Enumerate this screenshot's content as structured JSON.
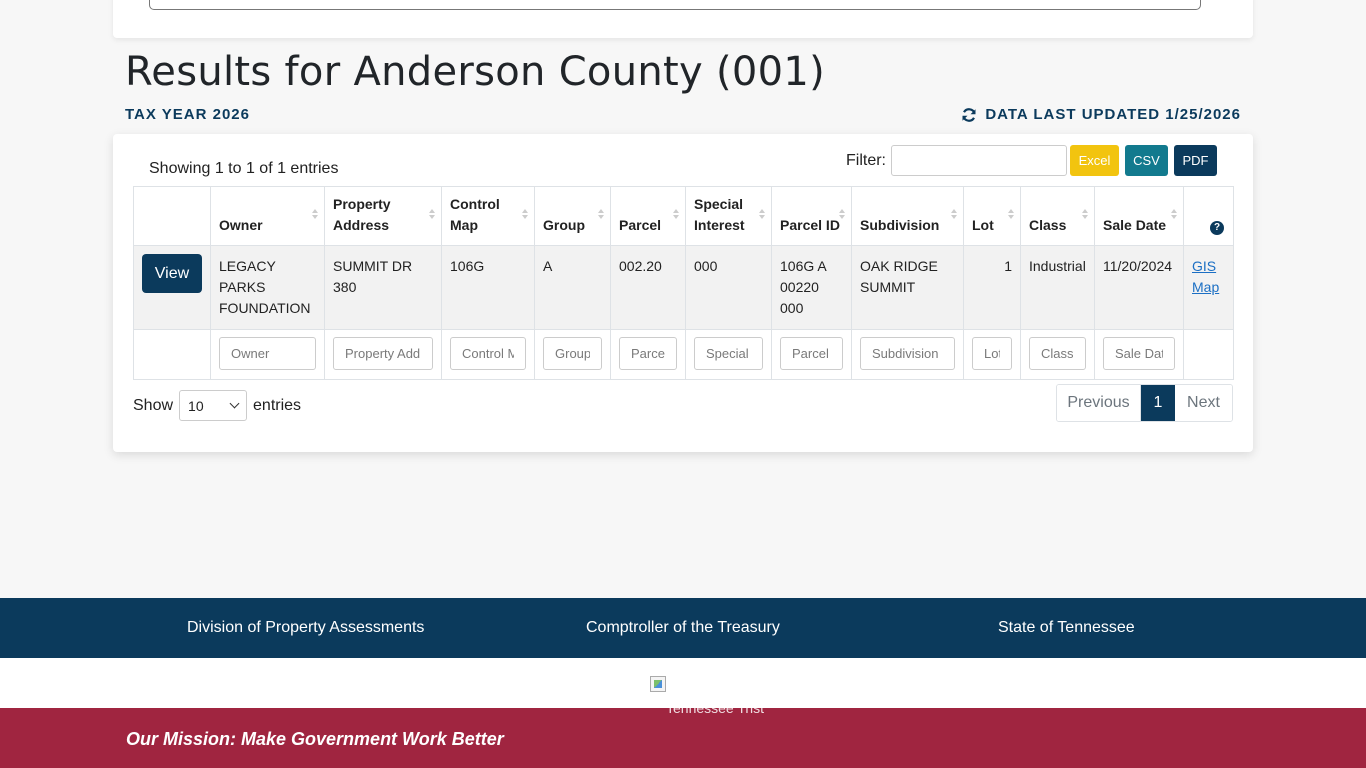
{
  "page": {
    "title": "Results for Anderson County (001)",
    "tax_year": "TAX YEAR 2026",
    "last_updated": "DATA LAST UPDATED 1/25/2026"
  },
  "table_controls": {
    "showing": "Showing 1 to 1 of 1 entries",
    "filter_label": "Filter:",
    "filter_value": "",
    "export_buttons": [
      "Excel",
      "CSV",
      "PDF"
    ]
  },
  "columns": [
    "Owner",
    "Property Address",
    "Control Map",
    "Group",
    "Parcel",
    "Special Interest",
    "Parcel ID",
    "Subdivision",
    "Lot",
    "Class",
    "Sale Date"
  ],
  "rows": [
    {
      "action": "View",
      "owner": "LEGACY PARKS FOUNDATION",
      "address": "SUMMIT DR 380",
      "control_map": "106G",
      "group": "A",
      "parcel": "002.20",
      "special_interest": "000",
      "parcel_id": "106G A 00220 000",
      "subdivision": "OAK RIDGE SUMMIT",
      "lot": "1",
      "class": "Industrial",
      "sale_date": "11/20/2024",
      "gis_link": "GIS Map"
    }
  ],
  "column_filters": {
    "placeholders": [
      "Owner",
      "Property Address",
      "Control Map",
      "Group",
      "Parcel",
      "Special Interest",
      "Parcel ID",
      "Subdivision",
      "Lot",
      "Class",
      "Sale Date"
    ]
  },
  "length_control": {
    "show": "Show",
    "value": "10",
    "entries": "entries"
  },
  "pagination": {
    "previous": "Previous",
    "current": "1",
    "next": "Next"
  },
  "footer": {
    "links": [
      "Division of Property Assessments",
      "Comptroller of the Treasury",
      "State of Tennessee"
    ],
    "image_alt": "Tennessee Trist",
    "mission": "Our Mission: Make Government Work Better"
  },
  "colors": {
    "navy": "#0b3a5c",
    "excel": "#f2c40f",
    "csv": "#127a8e",
    "mission_band": "#a02540"
  },
  "icons": [
    "refresh-icon",
    "help-icon",
    "sort-icon",
    "chevron-down-icon",
    "broken-image-icon"
  ]
}
